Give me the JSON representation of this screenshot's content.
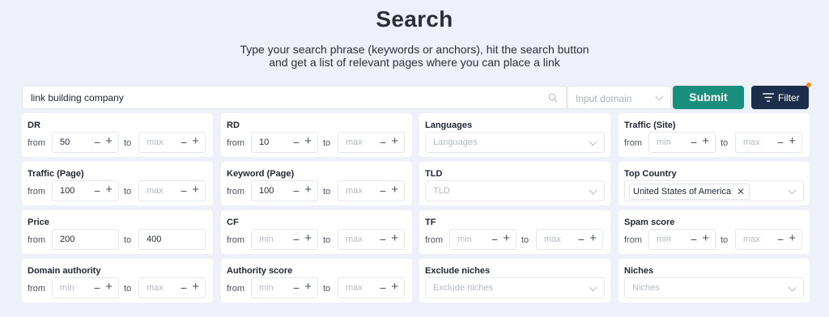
{
  "header": {
    "title": "Search",
    "subtitle_line1": "Type your search phrase (keywords or anchors), hit the search button",
    "subtitle_line2": "and get a list of relevant pages where you can place a link"
  },
  "search": {
    "query": "link building company",
    "domain_placeholder": "Input domain",
    "submit_label": "Submit",
    "filter_label": "Filter"
  },
  "labels": {
    "from": "from",
    "to": "to",
    "min_ph": "min",
    "max_ph": "max"
  },
  "filters": {
    "dr": {
      "label": "DR",
      "min": "50",
      "max": ""
    },
    "rd": {
      "label": "RD",
      "min": "10",
      "max": ""
    },
    "languages": {
      "label": "Languages",
      "placeholder": "Languages"
    },
    "traffic_site": {
      "label": "Traffic (Site)",
      "min": "",
      "max": ""
    },
    "traffic_page": {
      "label": "Traffic (Page)",
      "min": "100",
      "max": ""
    },
    "keyword_page": {
      "label": "Keyword (Page)",
      "min": "100",
      "max": ""
    },
    "tld": {
      "label": "TLD",
      "placeholder": "TLD"
    },
    "top_country": {
      "label": "Top Country",
      "selected": "United States of America"
    },
    "price": {
      "label": "Price",
      "min": "200",
      "max": "400"
    },
    "cf": {
      "label": "CF",
      "min": "",
      "max": ""
    },
    "tf": {
      "label": "TF",
      "min": "",
      "max": ""
    },
    "spam_score": {
      "label": "Spam score",
      "min": "",
      "max": ""
    },
    "domain_authority": {
      "label": "Domain authority",
      "min": "",
      "max": ""
    },
    "authority_score": {
      "label": "Authority score",
      "min": "",
      "max": ""
    },
    "exclude_niches": {
      "label": "Exclude niches",
      "placeholder": "Exclude niches"
    },
    "niches": {
      "label": "Niches",
      "placeholder": "Niches"
    }
  },
  "colors": {
    "accent_submit": "#1a8f7e",
    "filter_button": "#1b2f4d",
    "notification_dot": "#f08a24",
    "page_background": "#eef2f8"
  }
}
